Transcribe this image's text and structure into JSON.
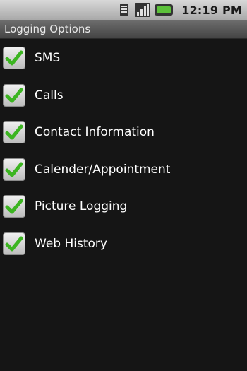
{
  "status_bar": {
    "time": "12:19 PM",
    "icons": [
      "sim-card-icon",
      "signal-strength-icon",
      "battery-icon"
    ]
  },
  "header": {
    "title": "Logging Options"
  },
  "options": [
    {
      "label": "SMS",
      "checked": true
    },
    {
      "label": "Calls",
      "checked": true
    },
    {
      "label": "Contact Information",
      "checked": true
    },
    {
      "label": "Calender/Appointment",
      "checked": true
    },
    {
      "label": "Picture Logging",
      "checked": true
    },
    {
      "label": "Web History",
      "checked": true
    }
  ],
  "colors": {
    "background": "#151515",
    "check_green": "#3cb521",
    "status_bar": "#b8b8b8",
    "battery_green": "#5cc13a"
  }
}
